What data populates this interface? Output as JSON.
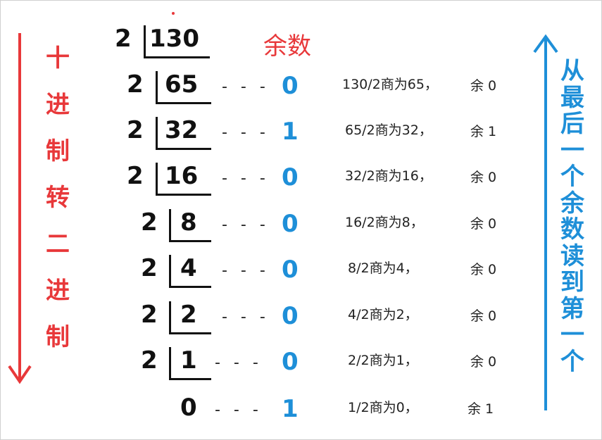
{
  "header": {
    "remainder_label": "余数"
  },
  "left_label": [
    "十",
    "进",
    "制",
    "转",
    "二",
    "进",
    "制"
  ],
  "right_label": [
    "从",
    "最",
    "后",
    "一",
    "个",
    "余",
    "数",
    "读",
    "到",
    "第",
    "一",
    "个"
  ],
  "steps": [
    {
      "divisor": "2",
      "dividend": "130",
      "remainder": "",
      "note_quot": "",
      "note_rem": ""
    },
    {
      "divisor": "2",
      "dividend": "65",
      "remainder": "0",
      "note_quot": "130/2商为65，",
      "note_rem": "余 0"
    },
    {
      "divisor": "2",
      "dividend": "32",
      "remainder": "1",
      "note_quot": "65/2商为32，",
      "note_rem": "余 1"
    },
    {
      "divisor": "2",
      "dividend": "16",
      "remainder": "0",
      "note_quot": "32/2商为16，",
      "note_rem": "余 0"
    },
    {
      "divisor": "2",
      "dividend": "8",
      "remainder": "0",
      "note_quot": "16/2商为8，",
      "note_rem": "余 0"
    },
    {
      "divisor": "2",
      "dividend": "4",
      "remainder": "0",
      "note_quot": "8/2商为4，",
      "note_rem": "余 0"
    },
    {
      "divisor": "2",
      "dividend": "2",
      "remainder": "0",
      "note_quot": "4/2商为2，",
      "note_rem": "余 0"
    },
    {
      "divisor": "2",
      "dividend": "1",
      "remainder": "0",
      "note_quot": "2/2商为1，",
      "note_rem": "余 0"
    },
    {
      "divisor": "",
      "dividend": "0",
      "remainder": "1",
      "note_quot": "1/2商为0，",
      "note_rem": "余 1"
    }
  ],
  "dash": "---",
  "colors": {
    "red": "#e8383a",
    "blue": "#1e8fd8",
    "text": "#111111"
  }
}
